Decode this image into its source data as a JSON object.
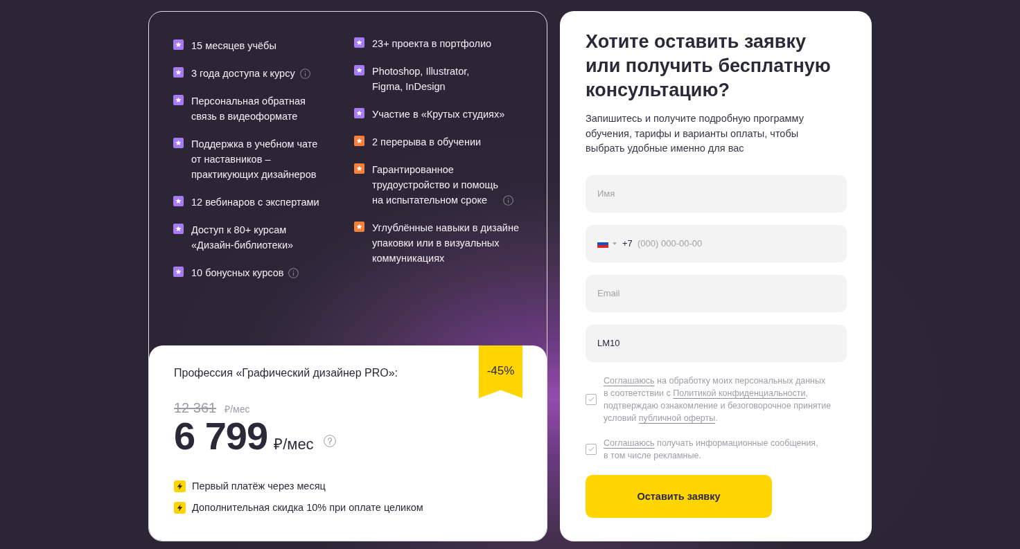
{
  "features": {
    "columns": [
      [
        {
          "text": "15 месяцев учёбы",
          "color": "#a77bf3",
          "info": false
        },
        {
          "text": "3 года доступа к курсу",
          "color": "#a77bf3",
          "info": true
        },
        {
          "text": "Персональная обратная\nсвязь в видеоформате",
          "color": "#a77bf3",
          "info": false
        },
        {
          "text": "Поддержка в учебном чате\nот наставников –\nпрактикующих дизайнеров",
          "color": "#a77bf3",
          "info": false
        },
        {
          "text": "12 вебинаров с экспертами",
          "color": "#a77bf3",
          "info": false
        },
        {
          "text": "Доступ к 80+ курсам\n«Дизайн-библиотеки»",
          "color": "#a77bf3",
          "info": false
        },
        {
          "text": "10 бонусных курсов",
          "color": "#a77bf3",
          "info": true
        }
      ],
      [
        {
          "text": "23+ проекта в портфолио",
          "color": "#a77bf3",
          "info": false
        },
        {
          "text": "Photoshop, Illustrator,\nFigma, InDesign",
          "color": "#a77bf3",
          "info": false
        },
        {
          "text": "Участие в «Крутых студиях»",
          "color": "#a77bf3",
          "info": false
        },
        {
          "text": "2 перерыва в обучении",
          "color": "#f7813a",
          "info": false
        },
        {
          "text": "Гарантированное\nтрудоустройство и помощь\nна испытательном сроке",
          "color": "#f7813a",
          "info": true
        },
        {
          "text": "Углублённые навыки в дизайне\nупаковки или в визуальных\nкоммуникациях",
          "color": "#f7813a",
          "info": false
        }
      ]
    ]
  },
  "offer": {
    "title": "Профессия «Графический дизайнер PRO»:",
    "discount": "-45%",
    "old_price": "12 361",
    "old_price_unit": "₽/мес",
    "price": "6 799",
    "price_unit": "₽/мес",
    "perks": [
      "Первый платёж через месяц",
      "Дополнительная скидка 10% при оплате целиком"
    ]
  },
  "form": {
    "heading": "Хотите оставить заявку\nили получить бесплатную\nконсультацию?",
    "subtitle": "Запишитесь и получите подробную программу\nобучения, тарифы и варианты оплаты, чтобы\nвыбрать удобные именно для вас",
    "fields": [
      {
        "kind": "text",
        "placeholder": "Имя"
      },
      {
        "kind": "phone",
        "prefix": "+7",
        "placeholder": "(000) 000-00-00"
      },
      {
        "kind": "text",
        "placeholder": "Email"
      },
      {
        "kind": "text",
        "value": "LM10"
      }
    ],
    "consents": [
      {
        "checked": true,
        "parts": [
          {
            "kind": "link",
            "text": "Соглашаюсь"
          },
          {
            "kind": "text",
            "text": " на обработку моих персональных данных\nв соответствии с "
          },
          {
            "kind": "link",
            "text": "Политикой конфиденциальности"
          },
          {
            "kind": "text",
            "text": ",\nподтверждаю ознакомление и безоговорочное принятие\nусловий "
          },
          {
            "kind": "link",
            "text": "публичной оферты"
          },
          {
            "kind": "text",
            "text": "."
          }
        ]
      },
      {
        "checked": true,
        "parts": [
          {
            "kind": "link",
            "text": "Соглашаюсь"
          },
          {
            "kind": "text",
            "text": " получать информационные сообщения,\nв том числе рекламные."
          }
        ]
      }
    ],
    "submit": "Оставить заявку"
  }
}
